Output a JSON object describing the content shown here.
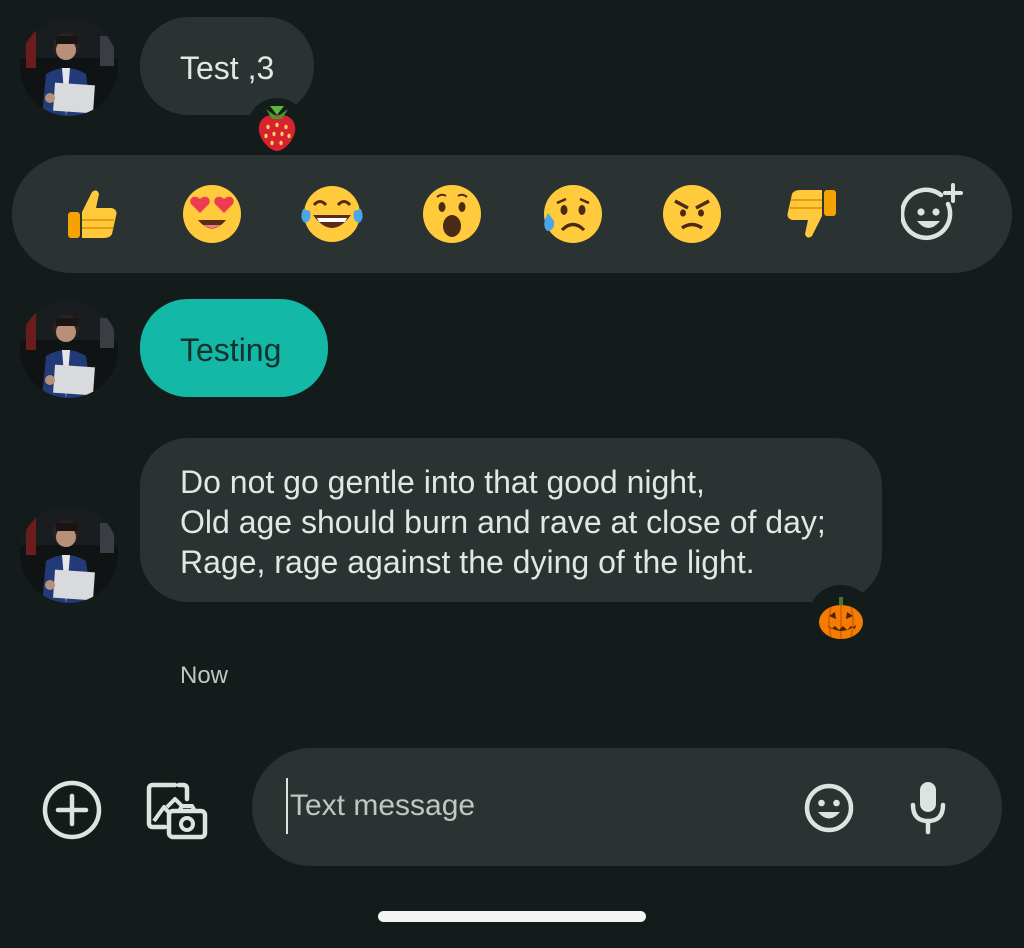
{
  "conversation": {
    "messages": [
      {
        "text_lines": [
          "Test ,3"
        ],
        "reaction": "strawberry-emoji",
        "selected": false
      },
      {
        "text_lines": [
          "Testing"
        ],
        "selected": true
      },
      {
        "text_lines": [
          "Do not go gentle into that good night,",
          "Old age should burn and rave at close of day;",
          "Rage, rage against the dying of the light."
        ],
        "reaction": "jack-o-lantern-emoji",
        "selected": false
      }
    ],
    "timestamp": "Now"
  },
  "reaction_picker": {
    "options": [
      "thumbs-up-emoji",
      "heart-eyes-emoji",
      "tears-of-joy-emoji",
      "astonished-emoji",
      "sad-sweat-emoji",
      "angry-emoji",
      "thumbs-down-emoji",
      "add-emoji-icon"
    ]
  },
  "composer": {
    "placeholder": "Text message",
    "value": "",
    "buttons": [
      "add-circle-icon",
      "gallery-camera-icon",
      "emoji-icon",
      "microphone-icon"
    ]
  },
  "colors": {
    "background": "#141c1b",
    "bubble_incoming": "#2a3331",
    "bubble_selected": "#14b8a6",
    "text": "#e3e6e5"
  }
}
